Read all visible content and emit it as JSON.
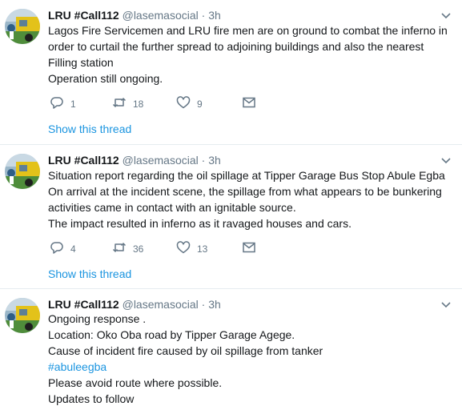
{
  "tweets": [
    {
      "name": "LRU #Call112",
      "handle": "@lasemasocial",
      "separator": "·",
      "time": "3h",
      "lines": [
        "Lagos Fire Servicemen and LRU fire men are on ground to combat the inferno in",
        "order to curtail the further spread to adjoining buildings and also the nearest",
        "Filling station",
        "Operation still ongoing."
      ],
      "replies": "1",
      "retweets": "18",
      "likes": "9",
      "thread_link": "Show this thread"
    },
    {
      "name": "LRU #Call112",
      "handle": "@lasemasocial",
      "separator": "·",
      "time": "3h",
      "lines": [
        "Situation report regarding the oil spillage at Tipper Garage Bus Stop Abule Egba",
        "On arrival at the incident scene, the spillage from what appears to be bunkering",
        "activities came in contact with an ignitable source.",
        "The impact resulted in inferno as it ravaged houses and cars."
      ],
      "replies": "4",
      "retweets": "36",
      "likes": "13",
      "thread_link": "Show this thread"
    },
    {
      "name": "LRU #Call112",
      "handle": "@lasemasocial",
      "separator": "·",
      "time": "3h",
      "lines": [
        "Ongoing response .",
        "Location: Oko Oba road by Tipper Garage Agege.",
        "Cause of incident fire caused by oil spillage from tanker",
        "#abuleegba",
        "Please avoid route where possible.",
        "Updates to follow"
      ]
    }
  ],
  "colors": {
    "text": "#14171a",
    "secondary": "#657786",
    "link": "#1b95e0",
    "divider": "#e6ecf0"
  },
  "icons": {
    "reply": "reply-icon",
    "retweet": "retweet-icon",
    "like": "heart-icon",
    "dm": "envelope-icon",
    "menu": "chevron-down-icon"
  }
}
